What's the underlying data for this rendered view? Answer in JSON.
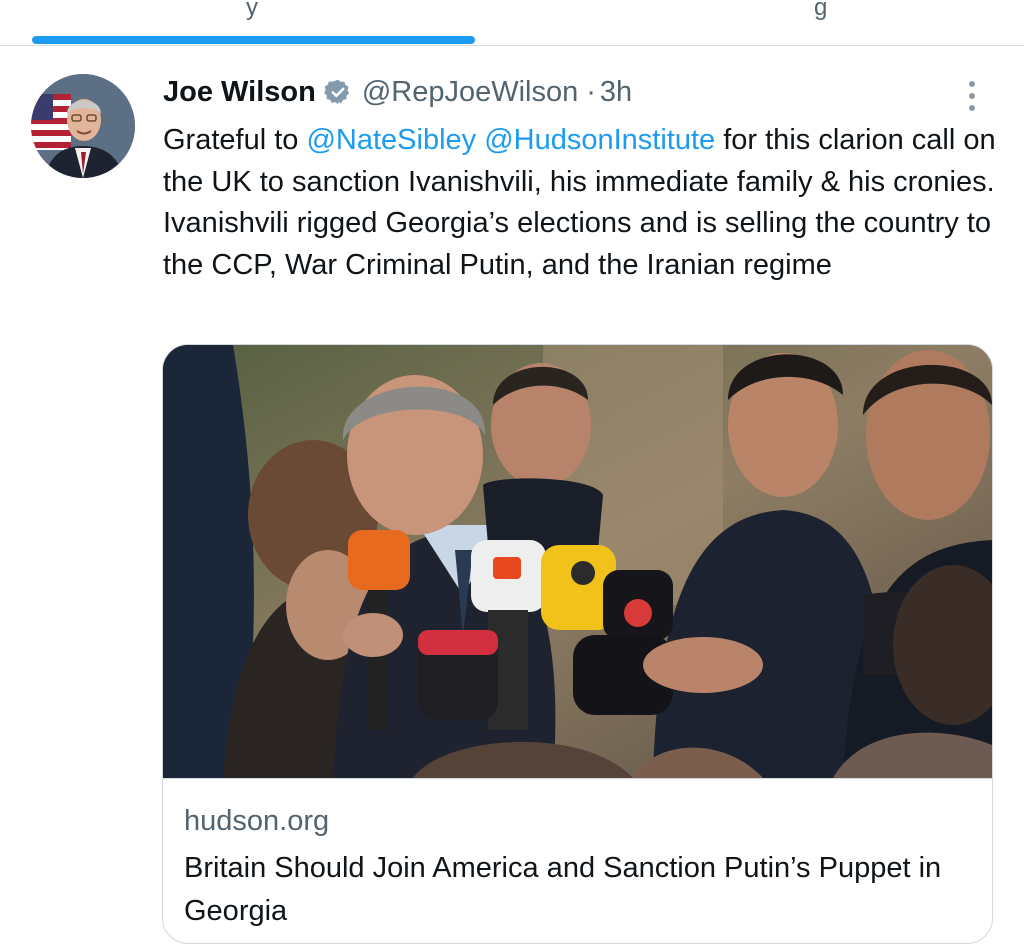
{
  "top_bar": {
    "partial_tab_left": "y",
    "partial_tab_right": "g"
  },
  "tweet": {
    "author": {
      "display_name": "Joe Wilson",
      "handle": "@RepJoeWilson",
      "separator": "·",
      "time": "3h",
      "verified": true
    },
    "text": {
      "part1": "Grateful to ",
      "mention1": "@NateSibley",
      "space": " ",
      "mention2": "@HudsonInstitute",
      "part2": " for this clarion call on the UK to sanction Ivanishvili, his immediate family & his cronies. Ivanishvili rigged Georgia’s elections and is selling the country to the CCP, War Criminal Putin, and the Iranian regime"
    },
    "card": {
      "domain": "hudson.org",
      "title": "Britain Should Join America and Sanction Putin’s Puppet in Georgia"
    }
  },
  "colors": {
    "accent": "#1d9bf0",
    "text": "#0f1419",
    "secondary_text": "#536471",
    "border": "#cfd9de"
  },
  "icons": {
    "verified": "verified-badge-icon",
    "more": "more-options-icon"
  }
}
